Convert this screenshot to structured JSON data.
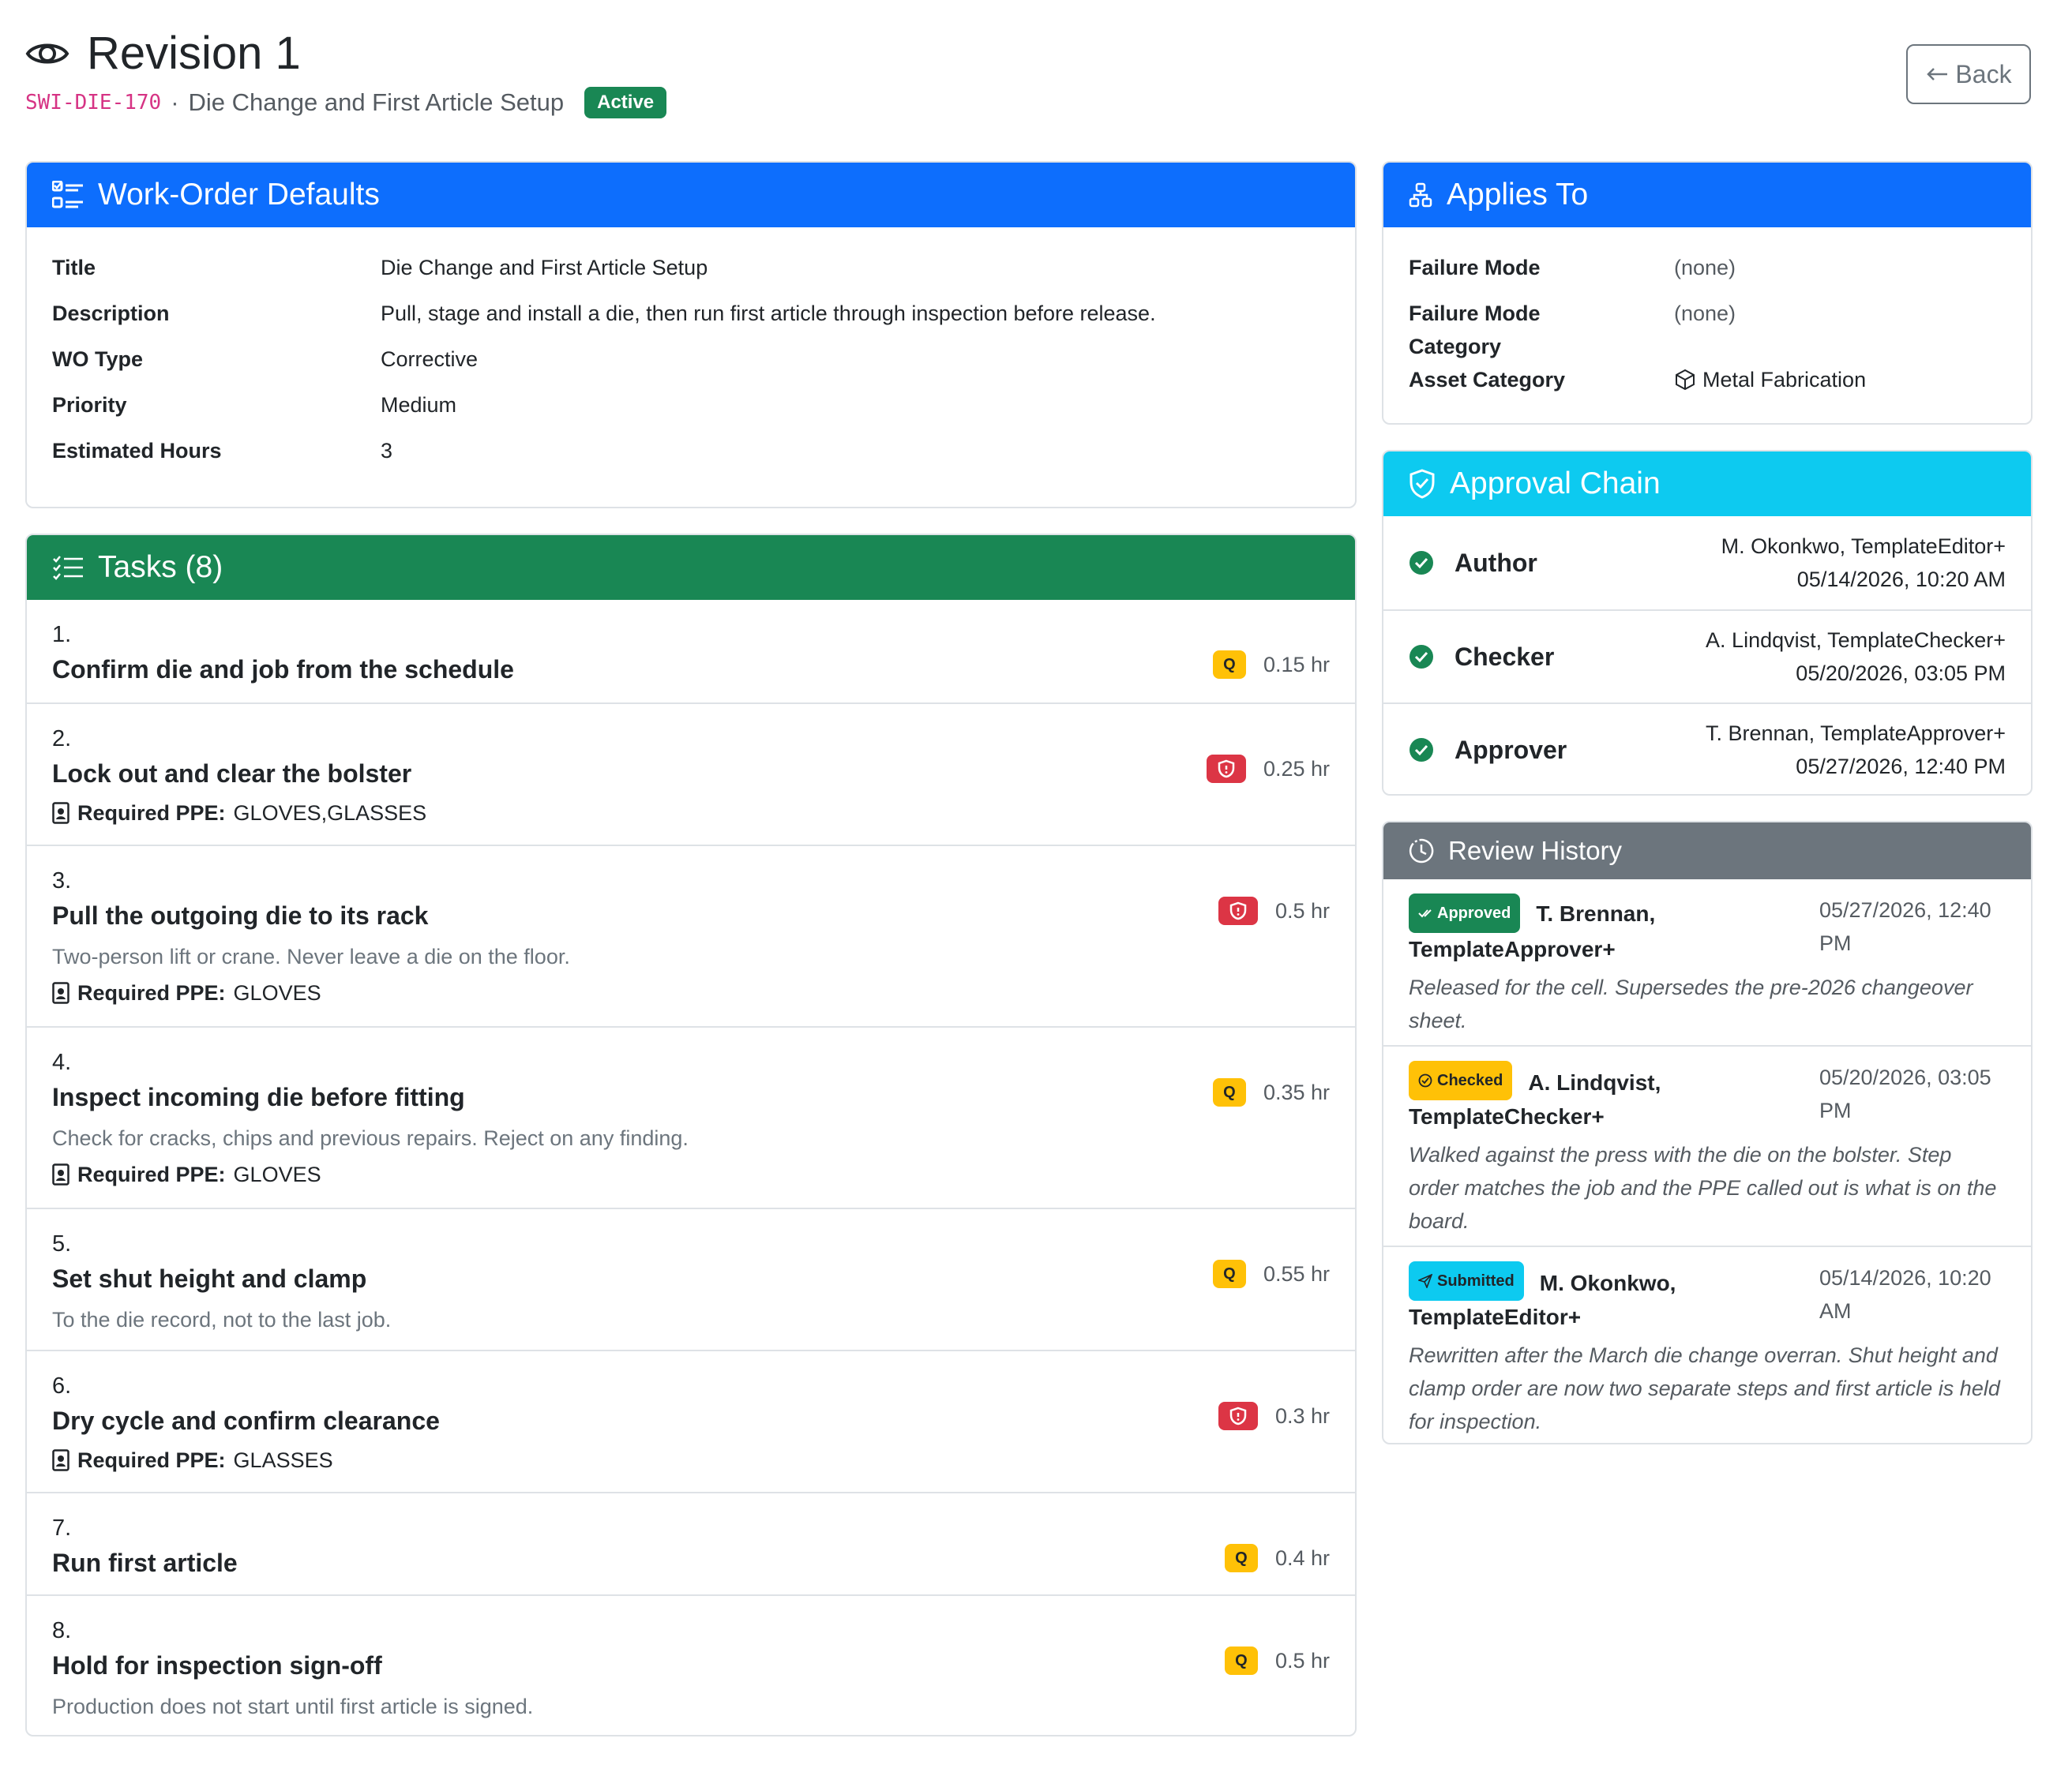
{
  "header": {
    "title": "Revision 1",
    "code": "SWI-DIE-170",
    "separator": "·",
    "subtitle": "Die Change and First Article Setup",
    "status": "Active",
    "back_label": "Back"
  },
  "defaults": {
    "heading": "Work-Order Defaults",
    "rows": [
      {
        "label": "Title",
        "value": "Die Change and First Article Setup"
      },
      {
        "label": "Description",
        "value": "Pull, stage and install a die, then run first article through inspection before release."
      },
      {
        "label": "WO Type",
        "value": "Corrective"
      },
      {
        "label": "Priority",
        "value": "Medium"
      },
      {
        "label": "Estimated Hours",
        "value": "3"
      }
    ]
  },
  "tasks": {
    "heading": "Tasks (8)",
    "ppe_label": "Required PPE:",
    "items": [
      {
        "num": "1.",
        "name": "Confirm die and job from the schedule",
        "desc": "",
        "ppe": "",
        "kind": "Q",
        "hours": "0.15 hr"
      },
      {
        "num": "2.",
        "name": "Lock out and clear the bolster",
        "desc": "",
        "ppe": "GLOVES,GLASSES",
        "kind": "safety",
        "hours": "0.25 hr"
      },
      {
        "num": "3.",
        "name": "Pull the outgoing die to its rack",
        "desc": "Two-person lift or crane. Never leave a die on the floor.",
        "ppe": "GLOVES",
        "kind": "safety",
        "hours": "0.5 hr"
      },
      {
        "num": "4.",
        "name": "Inspect incoming die before fitting",
        "desc": "Check for cracks, chips and previous repairs. Reject on any finding.",
        "ppe": "GLOVES",
        "kind": "Q",
        "hours": "0.35 hr"
      },
      {
        "num": "5.",
        "name": "Set shut height and clamp",
        "desc": "To the die record, not to the last job.",
        "ppe": "",
        "kind": "Q",
        "hours": "0.55 hr"
      },
      {
        "num": "6.",
        "name": "Dry cycle and confirm clearance",
        "desc": "",
        "ppe": "GLASSES",
        "kind": "safety",
        "hours": "0.3 hr"
      },
      {
        "num": "7.",
        "name": "Run first article",
        "desc": "",
        "ppe": "",
        "kind": "Q",
        "hours": "0.4 hr"
      },
      {
        "num": "8.",
        "name": "Hold for inspection sign-off",
        "desc": "Production does not start until first article is signed.",
        "ppe": "",
        "kind": "Q",
        "hours": "0.5 hr"
      }
    ]
  },
  "applies_to": {
    "heading": "Applies To",
    "failure_mode_label": "Failure Mode",
    "failure_mode_value": "(none)",
    "failure_mode_cat_label1": "Failure Mode",
    "failure_mode_cat_label2": "Category",
    "failure_mode_cat_value": "(none)",
    "asset_category_label": "Asset Category",
    "asset_category_value": "Metal Fabrication"
  },
  "approval": {
    "heading": "Approval Chain",
    "rows": [
      {
        "role": "Author",
        "who": "M. Okonkwo, TemplateEditor+",
        "when": "05/14/2026, 10:20 AM"
      },
      {
        "role": "Checker",
        "who": "A. Lindqvist, TemplateChecker+",
        "when": "05/20/2026, 03:05 PM"
      },
      {
        "role": "Approver",
        "who": "T. Brennan, TemplateApprover+",
        "when": "05/27/2026, 12:40 PM"
      }
    ]
  },
  "review": {
    "heading": "Review History",
    "items": [
      {
        "badge": "Approved",
        "who1": "T. Brennan,",
        "who2": "TemplateApprover+",
        "when1": "05/27/2026, 12:40",
        "when2": "PM",
        "note": "Released for the cell. Supersedes the pre-2026 changeover sheet."
      },
      {
        "badge": "Checked",
        "who1": "A. Lindqvist,",
        "who2": "TemplateChecker+",
        "when1": "05/20/2026, 03:05",
        "when2": "PM",
        "note": "Walked against the press with the die on the bolster. Step order matches the job and the PPE called out is what is on the board."
      },
      {
        "badge": "Submitted",
        "who1": "M. Okonkwo,",
        "who2": "TemplateEditor+",
        "when1": "05/14/2026, 10:20",
        "when2": "AM",
        "note": "Rewritten after the March die change overran. Shut height and clamp order are now two separate steps and first article is held for inspection."
      }
    ]
  },
  "colors": {
    "primary": "#0d6efd",
    "success": "#198754",
    "info": "#0dcaf0",
    "secondary": "#6c757d",
    "warning": "#ffc107",
    "danger": "#dc3545",
    "code": "#d63384"
  }
}
